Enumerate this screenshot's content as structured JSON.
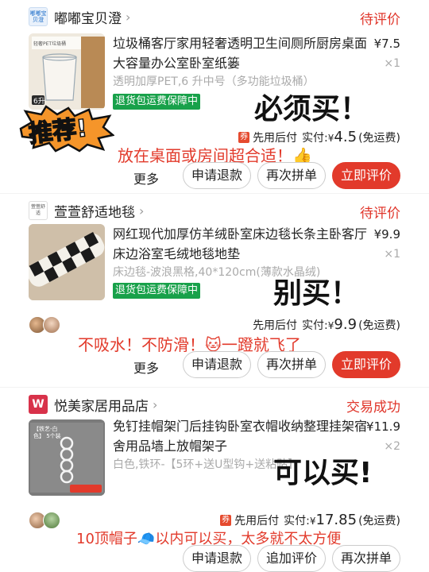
{
  "orders": [
    {
      "shop": {
        "name": "嘟嘟宝贝澄",
        "logo_text": "嘟嘟宝贝澄",
        "logo_color": "#1f6fc9"
      },
      "status": "待评价",
      "title": "垃圾桶客厅家用轻奢透明卫生间厕所厨房桌面大容量办公室卧室纸篓",
      "price": "¥7.5",
      "qty": "×1",
      "sku": "透明加厚PET,6 升中号（多功能垃圾桶）",
      "guarantee": "退货包运费保障中",
      "thumb_label": "6升",
      "pay_tag": "券",
      "pay_label": "先用后付",
      "paid_label": "实付:",
      "paid_symbol": "¥",
      "paid_amount": "4.5",
      "shipping_note": "(免运费)",
      "more": "更多",
      "buttons": [
        "申请退款",
        "再次拼单",
        "立即评价"
      ],
      "annotation_main": "必须买！",
      "annotation_sub": "放在桌面或房间超合适！👍",
      "sticker": "推荐!"
    },
    {
      "shop": {
        "name": "萱萱舒适地毯",
        "logo_text": "萱萱舒适",
        "logo_color": "#fff"
      },
      "status": "待评价",
      "title": "网红现代加厚仿羊绒卧室床边毯长条主卧客厅床边浴室毛绒地毯地垫",
      "price": "¥9.9",
      "qty": "×1",
      "sku": "床边毯-波浪黑格,40*120cm(薄款水晶绒)",
      "guarantee": "退货包运费保障中",
      "pay_label": "先用后付",
      "paid_label": "实付:",
      "paid_symbol": "¥",
      "paid_amount": "9.9",
      "shipping_note": "(免运费)",
      "more": "更多",
      "buttons": [
        "申请退款",
        "再次拼单",
        "立即评价"
      ],
      "annotation_main": "别买！",
      "annotation_sub": "不吸水！不防滑！🐱一蹬就飞了"
    },
    {
      "shop": {
        "name": "悦美家居用品店",
        "logo_text": "W",
        "logo_color": "#d8324a"
      },
      "status": "交易成功",
      "title": "免钉挂帽架门后挂钩卧室衣帽收纳整理挂架宿舍用品墙上放帽架子",
      "price": "¥11.9",
      "qty": "×2",
      "sku": "白色,铁环-【5环+送U型钩+送粘贴】",
      "thumb_label": "【铁艺-白色】 5个装",
      "pay_tag": "券",
      "pay_label": "先用后付",
      "paid_label": "实付:",
      "paid_symbol": "¥",
      "paid_amount": "17.85",
      "shipping_note": "(免运费)",
      "buttons": [
        "申请退款",
        "追加评价",
        "再次拼单"
      ],
      "annotation_main": "可以买!",
      "annotation_sub": "10顶帽子🧢以内可以买，太多就不太方便"
    }
  ],
  "colors": {
    "accent_red": "#e23a2b",
    "green_tag": "#18a14a",
    "muted": "#aaaaaa"
  },
  "icons": {
    "chevron": "chevron-right-icon",
    "thumbs_up": "thumbs-up-icon"
  }
}
